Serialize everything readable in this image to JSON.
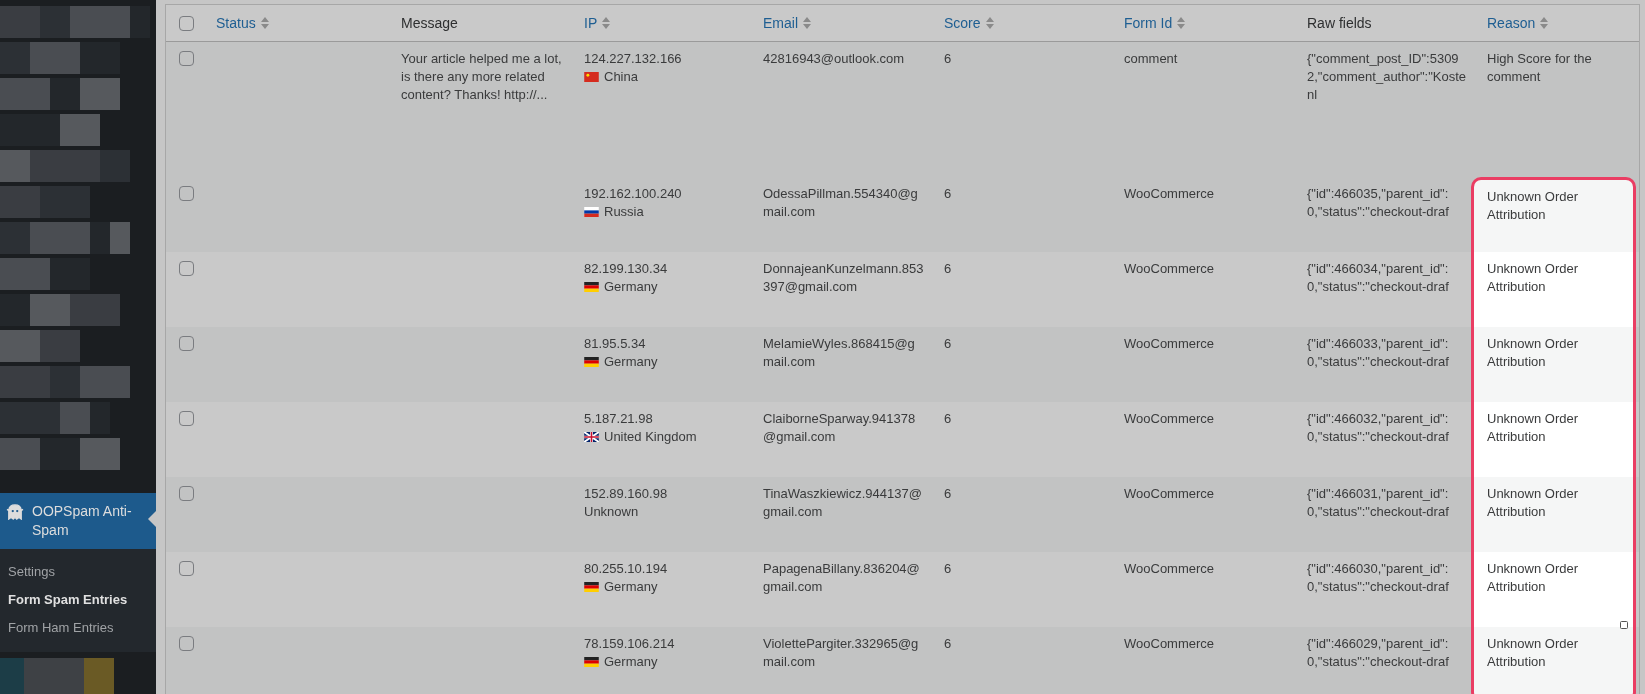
{
  "sidebar": {
    "active_item": {
      "label": "OOPSpam Anti-Spam",
      "selected": true
    },
    "submenu": [
      {
        "label": "Settings",
        "selected": false
      },
      {
        "label": "Form Spam Entries",
        "selected": true
      },
      {
        "label": "Form Ham Entries",
        "selected": false
      }
    ]
  },
  "table": {
    "columns": [
      {
        "label": "Status",
        "sortable": true
      },
      {
        "label": "Message",
        "sortable": false
      },
      {
        "label": "IP",
        "sortable": true
      },
      {
        "label": "Email",
        "sortable": true
      },
      {
        "label": "Score",
        "sortable": true
      },
      {
        "label": "Form Id",
        "sortable": true
      },
      {
        "label": "Raw fields",
        "sortable": false
      },
      {
        "label": "Reason",
        "sortable": true
      }
    ],
    "select_all": {
      "checked": false
    },
    "rows": [
      {
        "checked": false,
        "message": "Your article helped me a lot, is there any more related content? Thanks! http://...",
        "ip": "124.227.132.166",
        "kind": "china",
        "country": "China",
        "email": "42816943@outlook.com",
        "score": "6",
        "form_id": "comment",
        "raw_fields": "{\"comment_post_ID\":53092,\"comment_author\":\"Kostenl",
        "reason": "High Score for the comment",
        "highlighted": false
      },
      {
        "checked": false,
        "ip": "192.162.100.240",
        "kind": "russia",
        "country": "Russia",
        "email": "OdessaPillman.554340@gmail.com",
        "score": "6",
        "form_id": "WooCommerce",
        "raw_fields": "{\"id\":466035,\"parent_id\":0,\"status\":\"checkout-draf",
        "reason": "Unknown Order Attribution",
        "highlighted": true
      },
      {
        "checked": false,
        "ip": "82.199.130.34",
        "kind": "germany",
        "country": "Germany",
        "email": "DonnajeanKunzelmann.853397@gmail.com",
        "score": "6",
        "form_id": "WooCommerce",
        "raw_fields": "{\"id\":466034,\"parent_id\":0,\"status\":\"checkout-draf",
        "reason": "Unknown Order Attribution",
        "highlighted": true
      },
      {
        "checked": false,
        "ip": "81.95.5.34",
        "kind": "germany",
        "country": "Germany",
        "email": "MelamieWyles.868415@gmail.com",
        "score": "6",
        "form_id": "WooCommerce",
        "raw_fields": "{\"id\":466033,\"parent_id\":0,\"status\":\"checkout-draf",
        "reason": "Unknown Order Attribution",
        "highlighted": true
      },
      {
        "checked": false,
        "ip": "5.187.21.98",
        "kind": "uk",
        "country": "United Kingdom",
        "email": "ClaiborneSparway.941378@gmail.com",
        "score": "6",
        "form_id": "WooCommerce",
        "raw_fields": "{\"id\":466032,\"parent_id\":0,\"status\":\"checkout-draf",
        "reason": "Unknown Order Attribution",
        "highlighted": true
      },
      {
        "checked": false,
        "ip": "152.89.160.98",
        "kind": "unflagged",
        "country": "Unknown",
        "email": "TinaWaszkiewicz.944137@gmail.com",
        "score": "6",
        "form_id": "WooCommerce",
        "raw_fields": "{\"id\":466031,\"parent_id\":0,\"status\":\"checkout-draf",
        "reason": "Unknown Order Attribution",
        "highlighted": true
      },
      {
        "checked": false,
        "ip": "80.255.10.194",
        "kind": "germany",
        "country": "Germany",
        "email": "PapagenaBillany.836204@gmail.com",
        "score": "6",
        "form_id": "WooCommerce",
        "raw_fields": "{\"id\":466030,\"parent_id\":0,\"status\":\"checkout-draf",
        "reason": "Unknown Order Attribution",
        "highlighted": true
      },
      {
        "checked": false,
        "ip": "78.159.106.214",
        "kind": "germany",
        "country": "Germany",
        "email": "ViolettePargiter.332965@gmail.com",
        "score": "6",
        "form_id": "WooCommerce",
        "raw_fields": "{\"id\":466029,\"parent_id\":0,\"status\":\"checkout-draf",
        "reason": "Unknown Order Attribution",
        "highlighted": true
      }
    ]
  }
}
